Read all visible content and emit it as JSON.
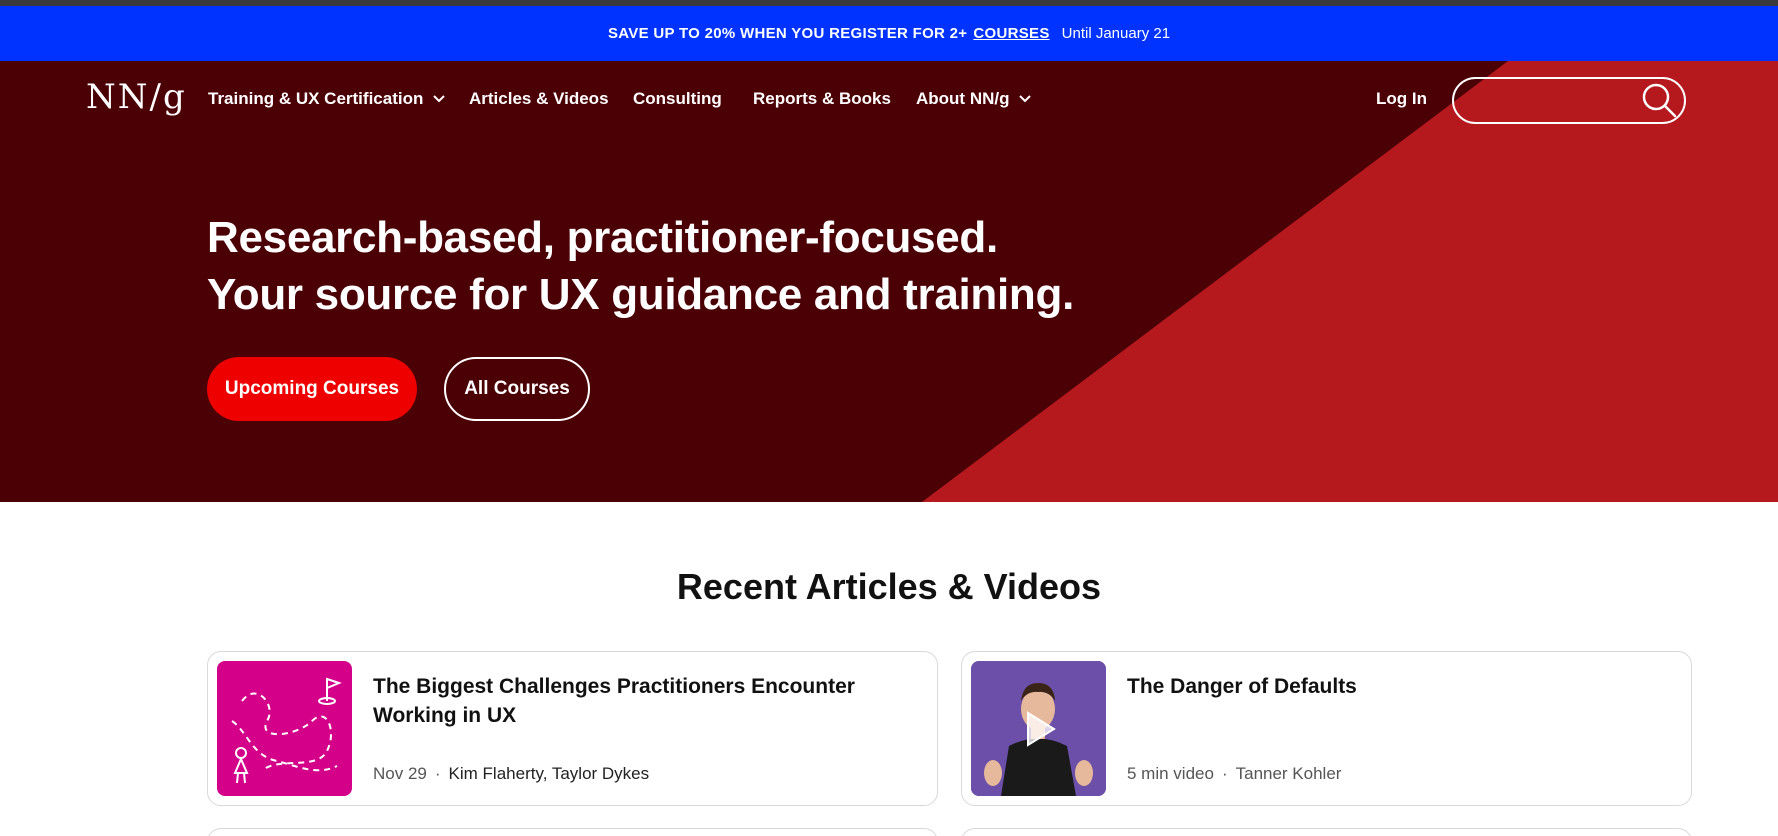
{
  "promo": {
    "text": "SAVE UP TO 20% WHEN YOU REGISTER FOR 2+",
    "link": "COURSES",
    "until": "Until January 21"
  },
  "nav": {
    "logo": "NN/g",
    "items": [
      {
        "label": "Training & UX Certification",
        "dropdown": true
      },
      {
        "label": "Articles & Videos",
        "dropdown": false
      },
      {
        "label": "Consulting",
        "dropdown": false
      },
      {
        "label": "Reports & Books",
        "dropdown": false
      },
      {
        "label": "About NN/g",
        "dropdown": true
      }
    ],
    "login": "Log In",
    "search_value": ""
  },
  "hero": {
    "line1": "Research-based, practitioner-focused.",
    "line2": "Your source for UX guidance and training.",
    "primary_button": "Upcoming Courses",
    "secondary_button": "All Courses"
  },
  "recent": {
    "title": "Recent Articles & Videos",
    "cards": [
      {
        "title": "The Biggest Challenges Practitioners Encounter Working in UX",
        "date": "Nov 29",
        "authors": "Kim Flaherty,  Taylor Dykes",
        "thumb": "journey-map-illustration"
      },
      {
        "title": "The Danger of Defaults",
        "date": "5 min video",
        "authors": "Tanner Kohler",
        "thumb": "video-presenter"
      }
    ]
  },
  "colors": {
    "promo_blue": "#0033ff",
    "hero_dark": "#4a0005",
    "hero_red": "#b5191e",
    "button_red": "#ee0000",
    "thumb_magenta": "#d4008a",
    "thumb_purple": "#6b4fa8"
  }
}
